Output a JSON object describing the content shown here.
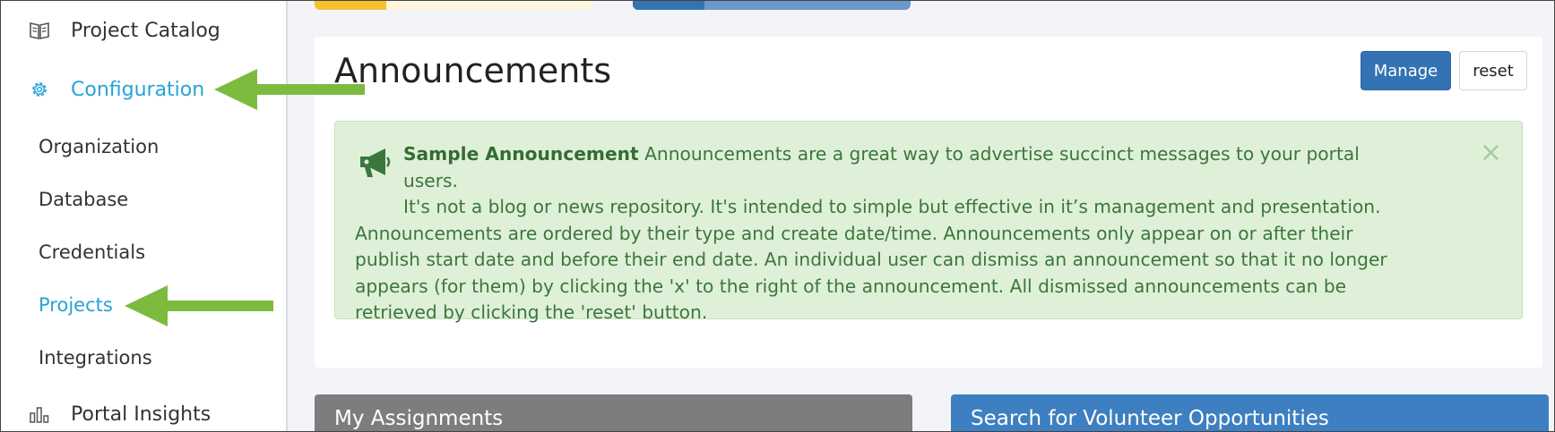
{
  "sidebar": {
    "items": [
      {
        "label": "Project Catalog",
        "icon": "book-icon"
      },
      {
        "label": "Configuration",
        "icon": "gear-icon"
      },
      {
        "label": "Portal Insights",
        "icon": "bar-chart-icon"
      }
    ],
    "subitems": [
      {
        "label": "Organization"
      },
      {
        "label": "Database"
      },
      {
        "label": "Credentials"
      },
      {
        "label": "Projects"
      },
      {
        "label": "Integrations"
      }
    ]
  },
  "announcements": {
    "title": "Announcements",
    "manage_label": "Manage",
    "reset_label": "reset",
    "alert": {
      "heading": "Sample Announcement",
      "line1": " Announcements are a great way to advertise succinct messages to your portal users.",
      "line2": "It's not a blog or news repository. It's intended to simple but effective in it’s management and presentation.",
      "rest": "Announcements are ordered by their type and create date/time. Announcements only appear on or after their publish start date and before their end date. An individual user can dismiss an announcement so that it no longer appears (for them) by clicking the 'x' to the right of the announcement. All dismissed announcements can be retrieved by clicking the 'reset' button.",
      "close_glyph": "×"
    }
  },
  "panels": {
    "assignments_title": "My Assignments",
    "volunteer_title": "Search for Volunteer Opportunities"
  },
  "colors": {
    "accent": "#27a3d6",
    "manage_button": "#3373b3",
    "alert_bg": "#dff0d8",
    "alert_text": "#3c763d",
    "arrow": "#7dbb3f"
  }
}
